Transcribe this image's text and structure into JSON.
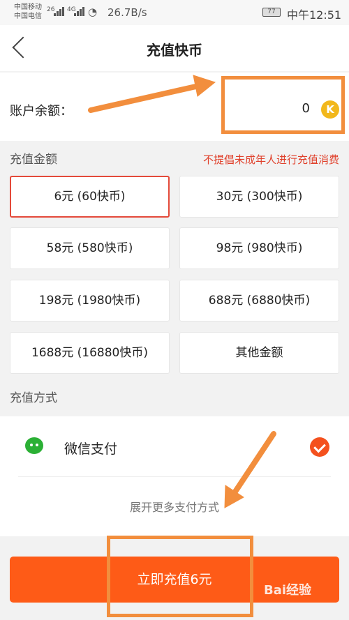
{
  "status_bar": {
    "carrier_1": "中国移动",
    "carrier_2": "中国电信",
    "net_1": "26",
    "net_2": "4G",
    "speed": "26.7B/s",
    "battery": "77",
    "time": "中午12:51"
  },
  "nav": {
    "title": "充值快币"
  },
  "balance": {
    "label": "账户余额：",
    "value": "0",
    "coin_glyph": "K"
  },
  "amount_section": {
    "label": "充值金额",
    "notice": "不提倡未成年人进行充值消费",
    "options": [
      "6元 (60快币)",
      "30元 (300快币)",
      "58元 (580快币)",
      "98元 (980快币)",
      "198元 (1980快币)",
      "688元 (6880快币)",
      "1688元 (16880快币)",
      "其他金额"
    ],
    "selected_index": 0
  },
  "payment": {
    "label": "充值方式",
    "method": "微信支付",
    "more": "展开更多支付方式"
  },
  "submit": {
    "label": "立即充值6元"
  },
  "watermark": "Bai经验",
  "colors": {
    "accent": "#fe5b17",
    "selected_border": "#e44a3a",
    "notice": "#e0402b",
    "annotation": "#f28e3d",
    "wechat": "#2bb035"
  }
}
